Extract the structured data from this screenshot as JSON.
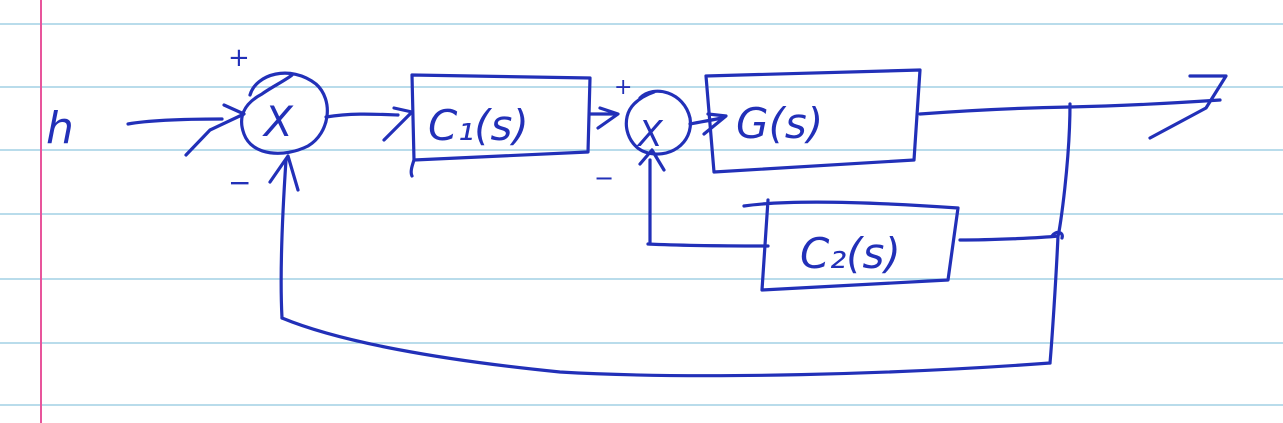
{
  "paper": {
    "rule_color": "#8fc7df",
    "margin_color": "#e8559c",
    "ink_color": "#2230b8"
  },
  "diagram": {
    "input_label": "h",
    "sum1": {
      "symbol": "X",
      "plus": "+",
      "minus": "−"
    },
    "sum2": {
      "symbol": "X",
      "plus": "+",
      "minus": "−"
    },
    "blocks": {
      "c1": "C₁(s)",
      "g": "G(s)",
      "c2": "C₂(s)"
    }
  }
}
